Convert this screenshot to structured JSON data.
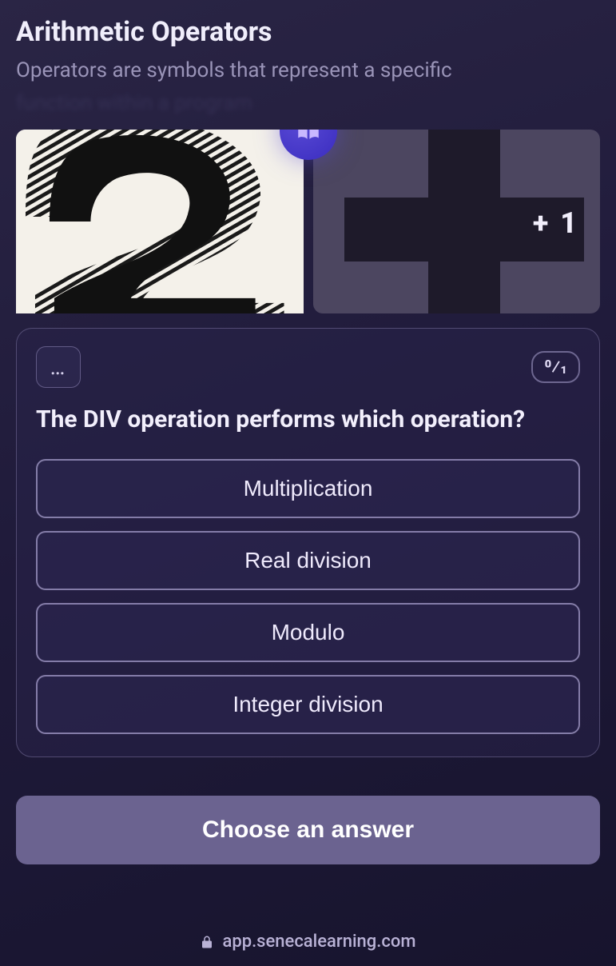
{
  "info": {
    "title": "Arithmetic Operators",
    "subtitle": "Operators are symbols that represent a specific",
    "faded": "function within a program"
  },
  "hero": {
    "badge_icon": "book-icon",
    "plus_label": "+ 1"
  },
  "question": {
    "more_icon": "…",
    "score": "0/1",
    "text": "The DIV operation performs which operation?",
    "options": [
      "Multiplication",
      "Real division",
      "Modulo",
      "Integer division"
    ]
  },
  "cta_label": "Choose an answer",
  "url": "app.senecalearning.com"
}
